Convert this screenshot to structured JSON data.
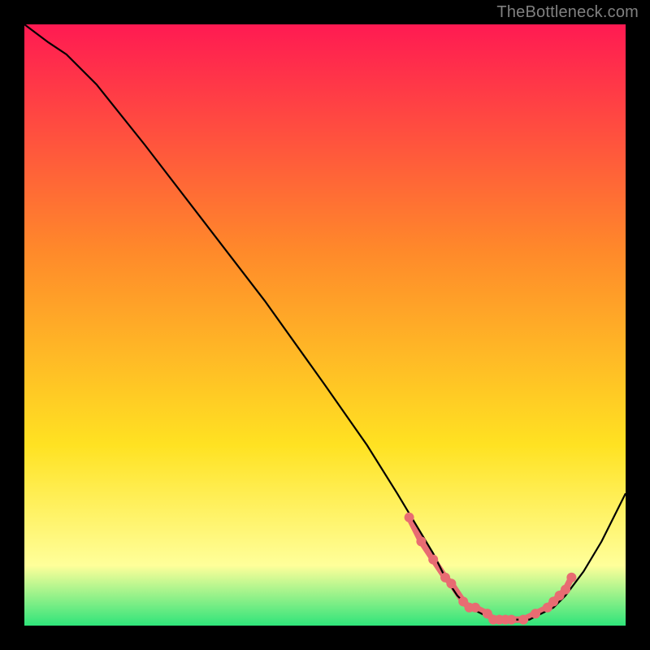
{
  "watermark": "TheBottleneck.com",
  "chart_data": {
    "type": "line",
    "title": "",
    "xlabel": "",
    "ylabel": "",
    "xlim": [
      0,
      100
    ],
    "ylim": [
      0,
      100
    ],
    "grid": false,
    "legend": false,
    "background_gradient": {
      "top": "#ff1a52",
      "mid1": "#ff8a2a",
      "mid2": "#ffe222",
      "mid3": "#ffff9a",
      "bottom": "#2fe47a"
    },
    "series": [
      {
        "name": "bottleneck-curve",
        "color": "#000000",
        "x": [
          0,
          4,
          7,
          12,
          20,
          30,
          40,
          50,
          57,
          62,
          65,
          68,
          70,
          72,
          74,
          76,
          78,
          80,
          82,
          84,
          86,
          88,
          90,
          93,
          96,
          100
        ],
        "values": [
          100,
          97,
          95,
          90,
          80,
          67,
          54,
          40,
          30,
          22,
          17,
          12,
          8,
          5,
          3,
          2,
          1,
          1,
          1,
          1,
          2,
          3,
          5,
          9,
          14,
          22
        ]
      }
    ],
    "markers": {
      "name": "highlight-points",
      "color": "#e86c72",
      "size": 5,
      "x": [
        64,
        66,
        68,
        70,
        71,
        73,
        74,
        75,
        77,
        78,
        79,
        80,
        81,
        83,
        85,
        87,
        88,
        89,
        90,
        91
      ],
      "values": [
        18,
        14,
        11,
        8,
        7,
        4,
        3,
        3,
        2,
        1,
        1,
        1,
        1,
        1,
        2,
        3,
        4,
        5,
        6,
        8
      ]
    }
  }
}
